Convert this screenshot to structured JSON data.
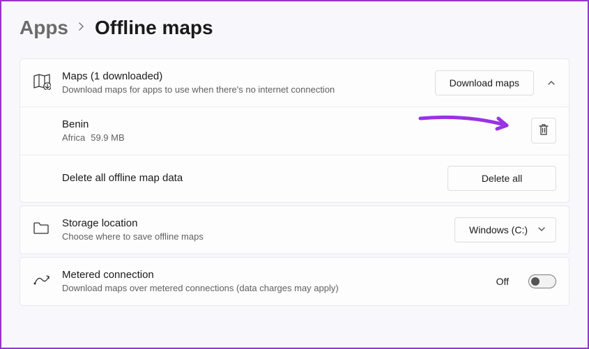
{
  "breadcrumb": {
    "parent": "Apps",
    "current": "Offline maps"
  },
  "maps_section": {
    "title": "Maps (1 downloaded)",
    "subtitle": "Download maps for apps to use when there's no internet connection",
    "download_button": "Download maps",
    "items": [
      {
        "name": "Benin",
        "region": "Africa",
        "size": "59.9 MB"
      }
    ],
    "delete_all_title": "Delete all offline map data",
    "delete_all_button": "Delete all"
  },
  "storage": {
    "title": "Storage location",
    "subtitle": "Choose where to save offline maps",
    "selected": "Windows (C:)"
  },
  "metered": {
    "title": "Metered connection",
    "subtitle": "Download maps over metered connections (data charges may apply)",
    "state_label": "Off"
  }
}
